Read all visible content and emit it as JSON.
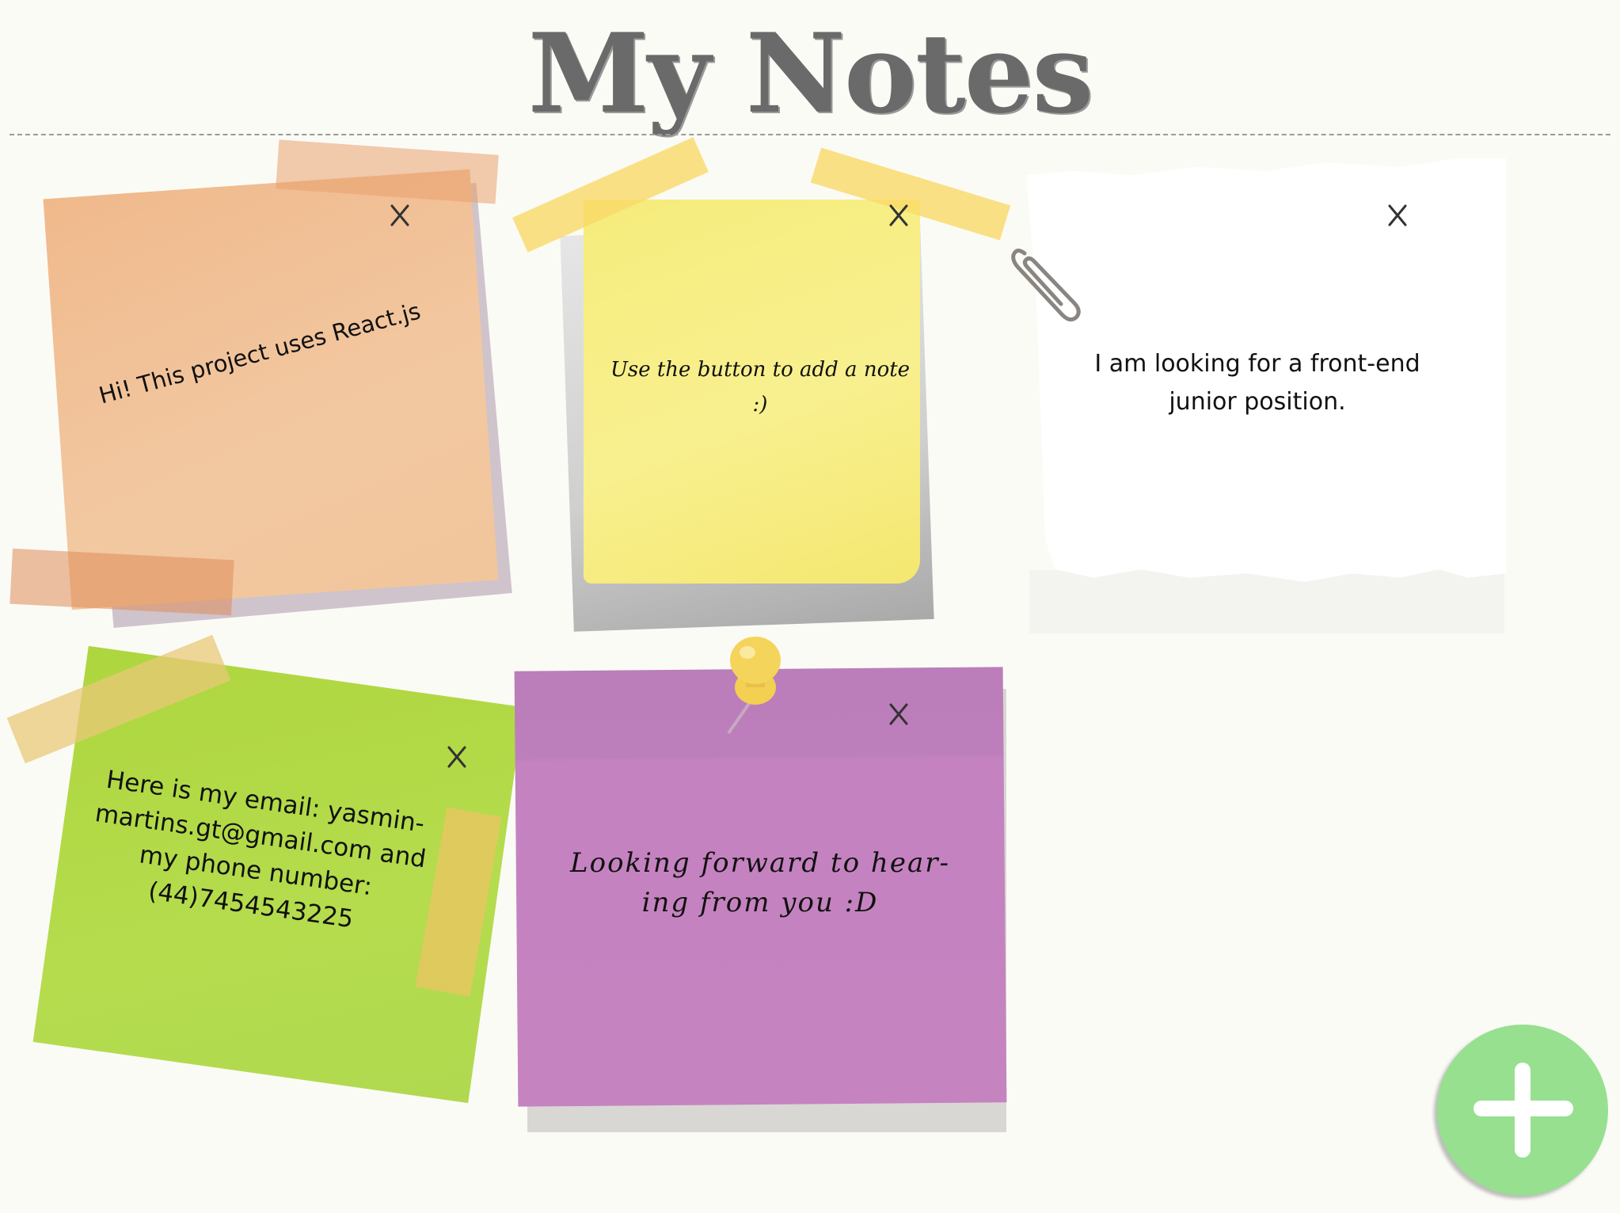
{
  "header": {
    "title": "My Notes"
  },
  "notes": [
    {
      "text": "Hi! This project uses React.js",
      "color": "#f2c8a1",
      "close_label": "X"
    },
    {
      "text": "Use the button to add a note :)",
      "color": "#f8f08f",
      "close_label": "X"
    },
    {
      "text": "I am looking for a front-end junior position.",
      "color": "#ffffff",
      "close_label": "X"
    },
    {
      "text": "Here is my email: yasmin-martins.gt@gmail.com and my phone number: (44)7454543225",
      "color": "#b5dc4d",
      "close_label": "X"
    },
    {
      "text": "Looking forward to hear- ing from you :D",
      "color": "#c583c0",
      "close_label": "X"
    }
  ],
  "add_button": {
    "icon": "plus-icon",
    "color": "#96e08f"
  }
}
